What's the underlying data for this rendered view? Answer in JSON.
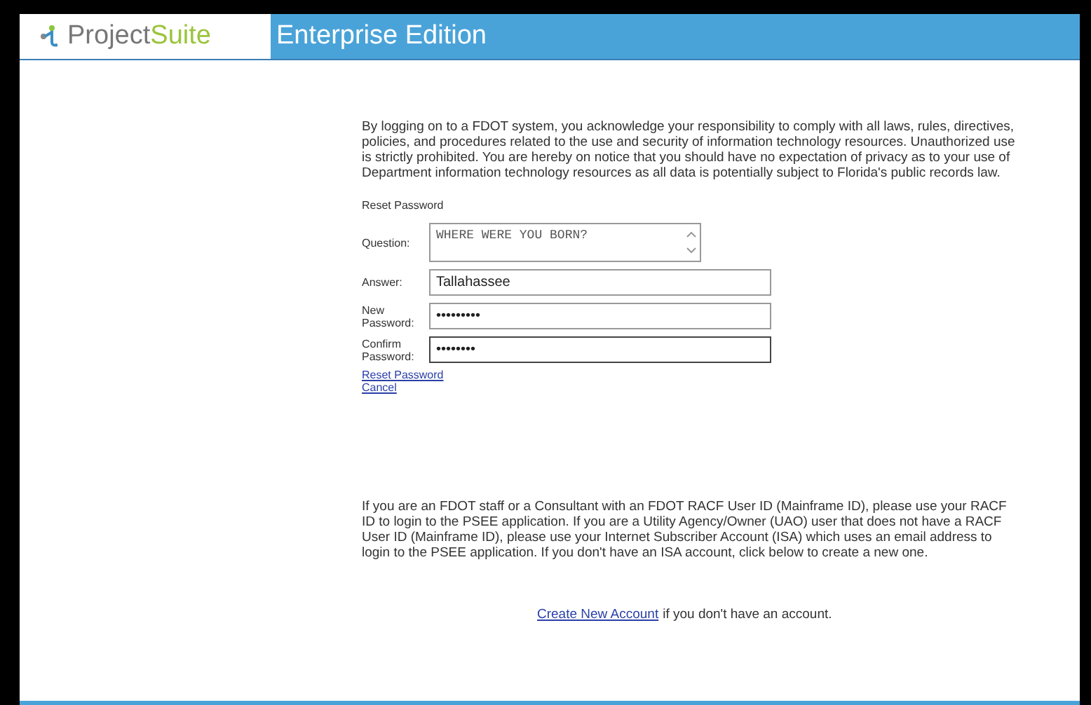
{
  "header": {
    "brand_first": "Project",
    "brand_second": "Suite",
    "edition": "Enterprise Edition"
  },
  "notice": "By logging on to a FDOT system, you acknowledge your responsibility to comply with all laws, rules, directives, policies, and procedures related to the use and security of information technology resources. Unauthorized use is strictly prohibited. You are hereby on notice that you should have no expectation of privacy as to your use of Department information technology resources as all data is potentially subject to Florida's public records law.",
  "form": {
    "title": "Reset Password",
    "fields": [
      {
        "kind": "textarea",
        "label": "Question:",
        "value": "WHERE WERE YOU BORN?",
        "focused": false
      },
      {
        "kind": "text",
        "label": "Answer:",
        "value": "Tallahassee",
        "focused": false
      },
      {
        "kind": "text",
        "label": "New Password:",
        "value": "•••••••••",
        "focused": false
      },
      {
        "kind": "text",
        "label": "Confirm Password:",
        "value": "••••••••",
        "focused": true
      }
    ],
    "links": [
      "Reset Password",
      "Cancel"
    ]
  },
  "info": "If you are an FDOT staff or a Consultant with an FDOT RACF User ID (Mainframe ID), please use your RACF ID to login to the PSEE application. If you are a Utility Agency/Owner (UAO) user that does not have a RACF User ID (Mainframe ID), please use your Internet Subscriber Account (ISA) which uses an email address to login to the PSEE application. If you don't have an ISA account, click below to create a new one.",
  "create": {
    "link": "Create New Account",
    "text": "if you don't have an account."
  }
}
